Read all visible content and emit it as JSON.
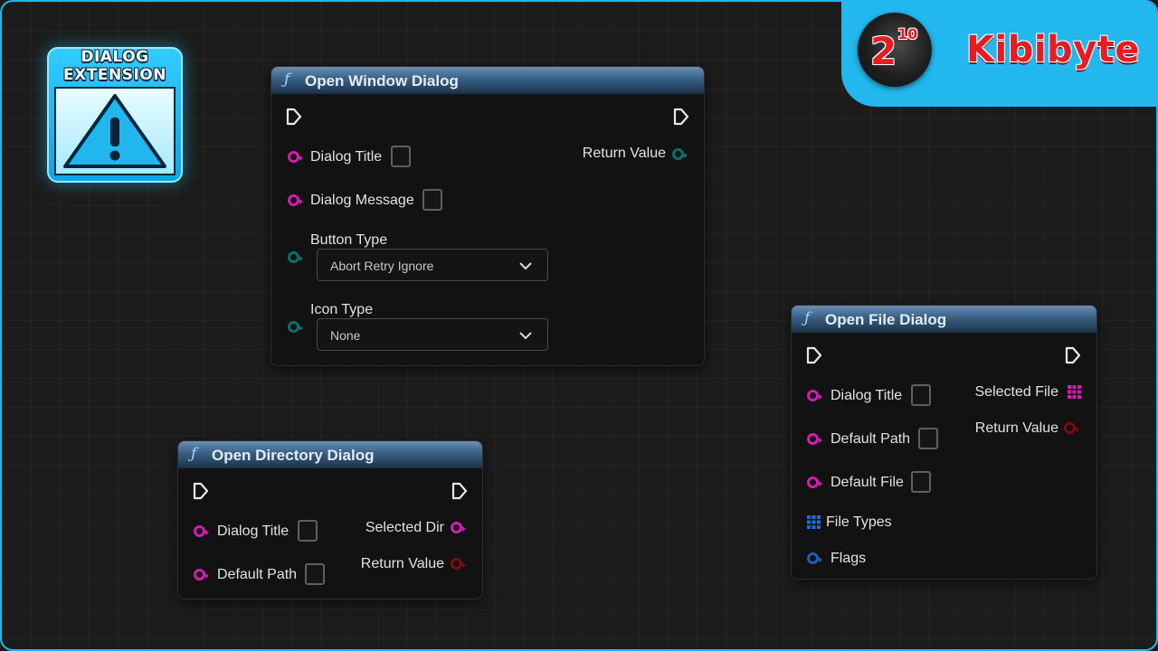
{
  "logo": {
    "line1": "DIALOG",
    "line2": "EXTENSION",
    "icon": "warning-triangle-icon"
  },
  "brand": {
    "base": "2",
    "exponent": "10",
    "name": "Kibibyte"
  },
  "colors": {
    "accent": "#20b7ee",
    "string_pin": "#d21eb0",
    "enum_pin": "#0e6e6a",
    "bool_pin": "#7a0d14",
    "int_pin": "#1b5fb8",
    "node_header": "#3c6389"
  },
  "nodes": {
    "open_window": {
      "title": "Open Window Dialog",
      "inputs": {
        "dialog_title": "Dialog Title",
        "dialog_message": "Dialog Message",
        "button_type": "Button Type",
        "button_type_value": "Abort Retry Ignore",
        "icon_type": "Icon Type",
        "icon_type_value": "None"
      },
      "outputs": {
        "return_value": "Return Value"
      }
    },
    "open_directory": {
      "title": "Open Directory Dialog",
      "inputs": {
        "dialog_title": "Dialog Title",
        "default_path": "Default Path"
      },
      "outputs": {
        "selected_dir": "Selected Dir",
        "return_value": "Return Value"
      }
    },
    "open_file": {
      "title": "Open File Dialog",
      "inputs": {
        "dialog_title": "Dialog Title",
        "default_path": "Default Path",
        "default_file": "Default File",
        "file_types": "File Types",
        "flags": "Flags"
      },
      "outputs": {
        "selected_file": "Selected File",
        "return_value": "Return Value"
      }
    }
  }
}
